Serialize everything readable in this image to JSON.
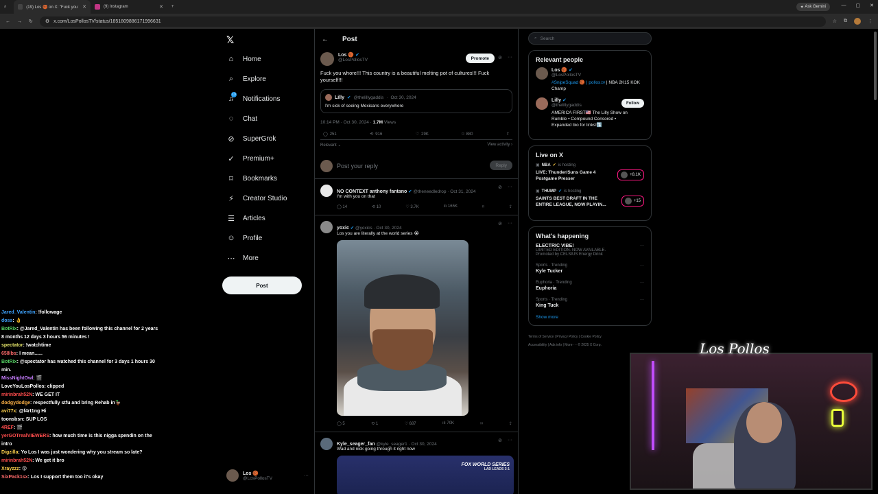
{
  "browser": {
    "tabs": [
      {
        "label": "(19) Los 🏀 on X: \"Fuck you wh",
        "active": true
      },
      {
        "label": "(9) Instagram",
        "active": false
      }
    ],
    "url": "x.com/LosPollosTV/status/1851809886171996631",
    "gemini_label": "Ask Gemini"
  },
  "nav": {
    "items": [
      {
        "label": "Home",
        "icon": "home-icon"
      },
      {
        "label": "Explore",
        "icon": "search-icon"
      },
      {
        "label": "Notifications",
        "icon": "bell-icon",
        "badge": "13"
      },
      {
        "label": "Chat",
        "icon": "chat-icon"
      },
      {
        "label": "SuperGrok",
        "icon": "grok-icon"
      },
      {
        "label": "Premium+",
        "icon": "premium-icon"
      },
      {
        "label": "Bookmarks",
        "icon": "bookmark-icon"
      },
      {
        "label": "Creator Studio",
        "icon": "creator-icon"
      },
      {
        "label": "Articles",
        "icon": "articles-icon"
      },
      {
        "label": "Profile",
        "icon": "profile-icon"
      },
      {
        "label": "More",
        "icon": "more-icon"
      }
    ],
    "post_label": "Post",
    "account": {
      "name": "Los 🏀",
      "handle": "@LosPollosTV"
    }
  },
  "post": {
    "header": "Post",
    "author": "Los 🏀",
    "handle": "@LosPollosTV",
    "promote_label": "Promote",
    "text": "Fuck you whore!!! This country is a beautiful melting pot of cultures!!! Fuck yourself!!!",
    "quote": {
      "author": "Lilly",
      "handle": "@thelillygaddis",
      "date": "Oct 30, 2024",
      "text": "I'm sick of seeing Mexicans everywhere"
    },
    "time": "10:14 PM · Oct 30, 2024 · ",
    "views": "1.7M",
    "views_label": "Views",
    "stats": {
      "replies": "251",
      "reposts": "916",
      "likes": "29K",
      "bookmarks": "880"
    },
    "relevant_label": "Relevant ⌄",
    "view_activity": "View activity ›"
  },
  "reply_box": {
    "placeholder": "Post your reply",
    "button": "Reply"
  },
  "replies": [
    {
      "author": "NO CONTEXT anthony fantano",
      "handle": "@theneedledrop · Oct 31, 2024",
      "text": "I'm with you on that",
      "stats": [
        "14",
        "10",
        "3.7K",
        "165K"
      ]
    },
    {
      "author": "yoxic",
      "handle": "@yoxics · Oct 30, 2024",
      "text": "Los you are literally at the world series 😭",
      "stats": [
        "5",
        "1",
        "687",
        "70K"
      ]
    },
    {
      "author": "Kyle_seager_fan",
      "handle": "@kyle_seager1 · Oct 30, 2024",
      "text": "Wad and nick going through it right now",
      "tv_label": "FOX WORLD SERIES",
      "tv_sub": "LAD LEADS 3-1"
    }
  ],
  "right": {
    "search_placeholder": "Search",
    "relevant_title": "Relevant people",
    "people": [
      {
        "name": "Los 🏀",
        "handle": "@LosPollosTV",
        "bio_link": "#SnipeSquad 🏀 | pollos.tv",
        "bio": " | NBA 2K15 KOK Champ"
      },
      {
        "name": "Lilly",
        "handle": "@thelillygaddis",
        "bio": "AMERICA FIRST🇺🇸 The Lilly Show on Rumble • Compound Censored • Expanded bio for links!⤵️",
        "follow": "Follow"
      }
    ],
    "live_title": "Live on X",
    "live": [
      {
        "host": "NBA",
        "hosting": "is hosting",
        "title": "LIVE: Thunder/Suns Game 4 Postgame Presser",
        "count": "+8.1K"
      },
      {
        "host": "THUMP",
        "hosting": "is hosting",
        "title": "SAINTS BEST DRAFT IN THE ENTIRE LEAGUE, NOW PLAYIN...",
        "count": "+15"
      }
    ],
    "happening_title": "What's happening",
    "trends": [
      {
        "cat": "",
        "title": "ELECTRIC VIBE!",
        "sub": "LIMITED EDITION. NOW AVAILABLE.",
        "promo": "Promoted by CELSIUS Energy Drink"
      },
      {
        "cat": "Sports · Trending",
        "title": "Kyle Tucker"
      },
      {
        "cat": "Euphoria · Trending",
        "title": "Euphoria"
      },
      {
        "cat": "Sports · Trending",
        "title": "King Tuck"
      }
    ],
    "show_more": "Show more",
    "footer1": "Terms of Service  |  Privacy Policy  |  Cookie Policy",
    "footer2": "Accessibility  |  Ads info  |  More ···  © 2025 X Corp."
  },
  "chat": [
    {
      "user": "Jared_Valentin",
      "color": "#3fa4ff",
      "msg": "!followage"
    },
    {
      "user": "doss",
      "color": "#3fa4ff",
      "msg": "👌"
    },
    {
      "user": "BotRix",
      "color": "#56d364",
      "msg": "@Jared_Valentin has been following this channel for 2 years 8 months 12 days 3 hours 56 minutes !"
    },
    {
      "user": "spectator",
      "color": "#e6e66a",
      "msg": "!watchtime"
    },
    {
      "user": "658lbs",
      "color": "#ff6b6b",
      "msg": "I mean......"
    },
    {
      "user": "BotRix",
      "color": "#56d364",
      "msg": "@spectator has watched this channel for 3 days 1 hours 30 min."
    },
    {
      "user": "MissNightOwl",
      "color": "#c77dff",
      "msg": "🎬"
    },
    {
      "user": "LoveYouLosPollos",
      "color": "#ffffff",
      "msg": "clipped"
    },
    {
      "user": "mirinbrah52N",
      "color": "#ff4d4d",
      "msg": "WE GET IT"
    },
    {
      "user": "dodgydodge",
      "color": "#ffb347",
      "msg": "respectfully stfu and bring Rehab in🦆"
    },
    {
      "user": "avi77x",
      "color": "#ffd24d",
      "msg": "@f4rt1ng Hi"
    },
    {
      "user": "toonsbsn",
      "color": "#ffffff",
      "msg": "SUP LOS"
    },
    {
      "user": "4REF",
      "color": "#ff4d4d",
      "msg": "🎬"
    },
    {
      "user": "yerGOTrealVIEWERS",
      "color": "#ff4d4d",
      "msg": "how much time is this nigga spendin on the intro"
    },
    {
      "user": "Digzilla",
      "color": "#ffd24d",
      "msg": "Yo Los I was just wondering why you stream so late?"
    },
    {
      "user": "mirinbrah52N",
      "color": "#ff4d4d",
      "msg": "We get it bro"
    },
    {
      "user": "Xrayzzz",
      "color": "#ffd24d",
      "msg": "😲"
    },
    {
      "user": "SixPack1sx",
      "color": "#ff6b6b",
      "msg": "Los I support them too it's okay"
    }
  ],
  "overlay": {
    "signature": "Los Pollos"
  }
}
